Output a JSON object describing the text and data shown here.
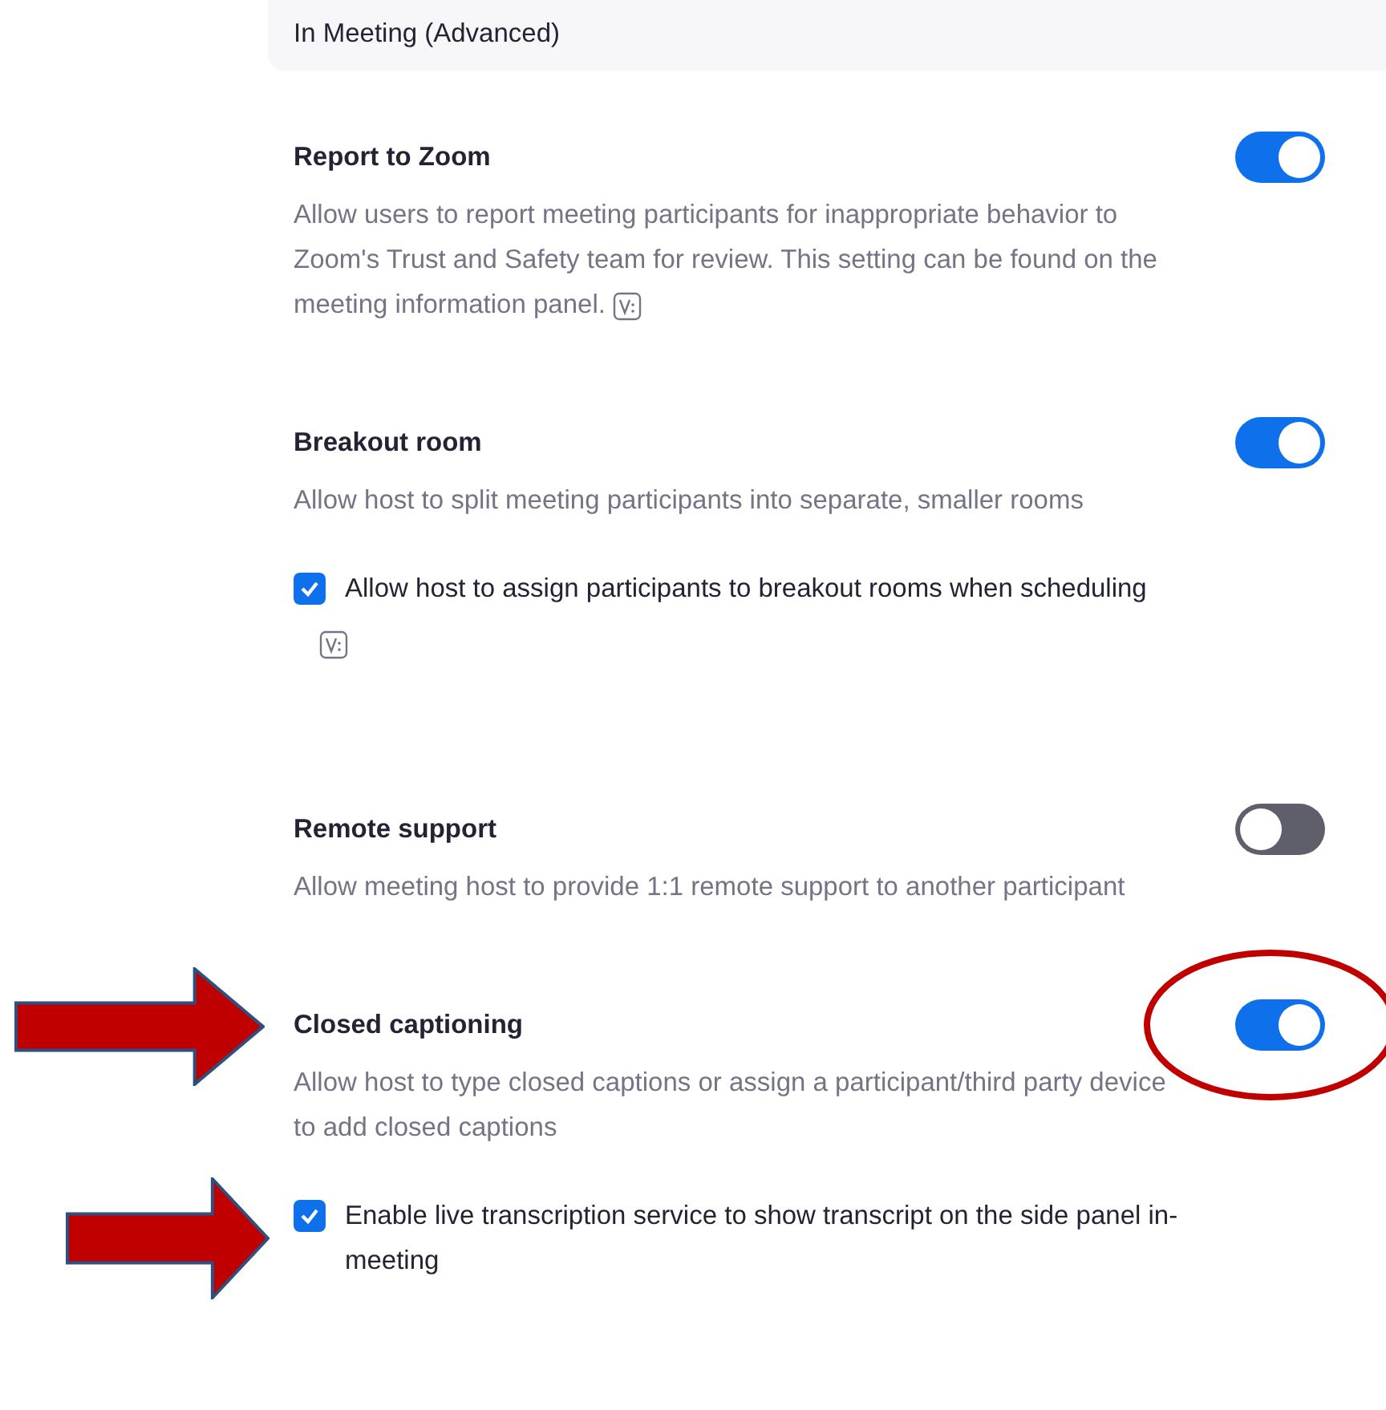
{
  "section_header": {
    "title": "In Meeting (Advanced)"
  },
  "settings": [
    {
      "title": "Report to Zoom",
      "description": "Allow users to report meeting participants for inappropriate behavior to Zoom's Trust and Safety team for review. This setting can be found on the meeting information panel.",
      "on": true,
      "info_icon": true,
      "highlighted": false
    },
    {
      "title": "Breakout room",
      "description": "Allow host to split meeting participants into separate, smaller rooms",
      "on": true,
      "info_icon": false,
      "highlighted": false,
      "options": [
        {
          "label": "Allow host to assign participants to breakout rooms when scheduling",
          "checked": true,
          "info_icon": true,
          "highlighted": false
        }
      ]
    },
    {
      "title": "Remote support",
      "description": "Allow meeting host to provide 1:1 remote support to another participant",
      "on": false,
      "info_icon": false,
      "highlighted": false
    },
    {
      "title": "Closed captioning",
      "description": "Allow host to type closed captions or assign a participant/third party device to add closed captions",
      "on": true,
      "info_icon": false,
      "highlighted": true,
      "options": [
        {
          "label": "Enable live transcription service to show transcript on the side panel in-meeting",
          "checked": true,
          "info_icon": false,
          "highlighted": true
        }
      ]
    }
  ]
}
